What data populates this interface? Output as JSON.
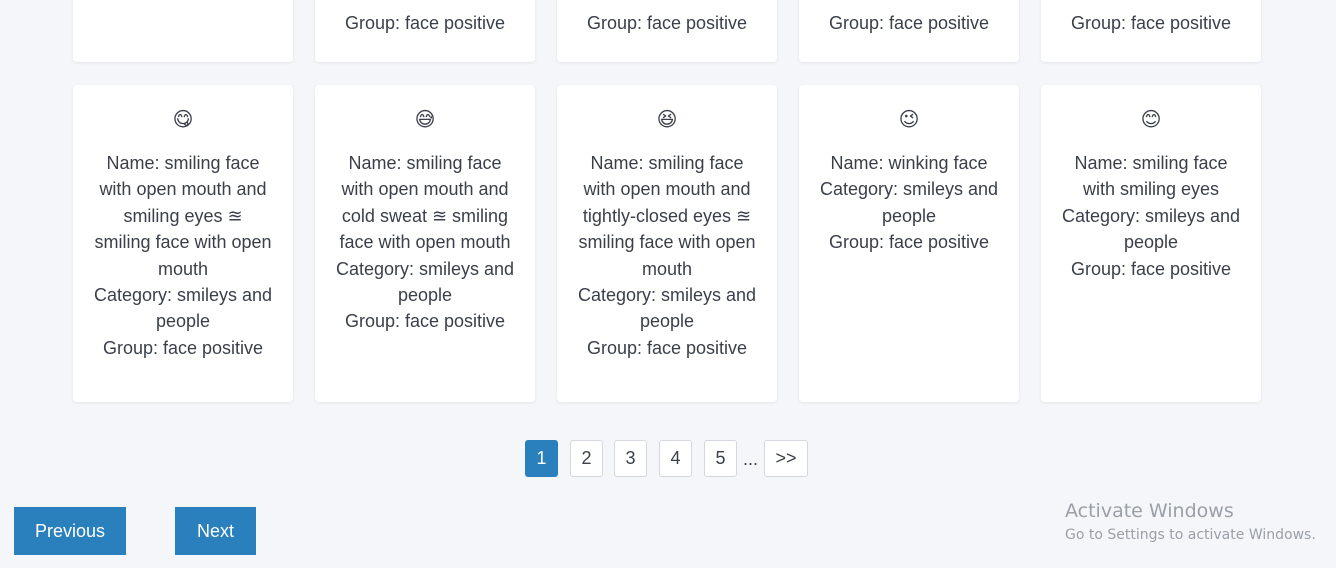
{
  "cards_top": [
    {
      "text": ""
    },
    {
      "text": "Group: face positive"
    },
    {
      "text": "Group: face positive"
    },
    {
      "text": "Group: face positive"
    },
    {
      "text": "Group: face positive"
    }
  ],
  "cards": [
    {
      "emoji": "😋",
      "emoji_icon": "smiling-face-open-mouth-smiling-eyes-icon",
      "lines": [
        "Name: smiling face with open mouth and smiling eyes ≊ smiling face with open mouth",
        "Category: smileys and people",
        "Group: face positive"
      ]
    },
    {
      "emoji": "😅",
      "emoji_icon": "smiling-face-cold-sweat-icon",
      "lines": [
        "Name: smiling face with open mouth and cold sweat ≊ smiling face with open mouth",
        "Category: smileys and people",
        "Group: face positive"
      ]
    },
    {
      "emoji": "😆",
      "emoji_icon": "smiling-face-tightly-closed-eyes-icon",
      "lines": [
        "Name: smiling face with open mouth and tightly-closed eyes ≊ smiling face with open mouth",
        "Category: smileys and people",
        "Group: face positive"
      ]
    },
    {
      "emoji": "😉",
      "emoji_icon": "winking-face-icon",
      "lines": [
        "Name: winking face",
        "Category: smileys and people",
        "Group: face positive"
      ]
    },
    {
      "emoji": "😊",
      "emoji_icon": "smiling-face-smiling-eyes-icon",
      "lines": [
        "Name: smiling face with smiling eyes",
        "Category: smileys and people",
        "Group: face positive"
      ]
    }
  ],
  "pagination": {
    "pages": [
      "1",
      "2",
      "3",
      "4",
      "5"
    ],
    "current": "1",
    "ellipsis": "...",
    "next": ">>"
  },
  "buttons": {
    "previous": "Previous",
    "next": "Next"
  },
  "watermark": {
    "title": "Activate Windows",
    "subtitle": "Go to Settings to activate Windows."
  },
  "colors": {
    "accent": "#2a7fbd",
    "background": "#f4f6fa",
    "card": "#ffffff",
    "text": "#3a3f4a"
  }
}
